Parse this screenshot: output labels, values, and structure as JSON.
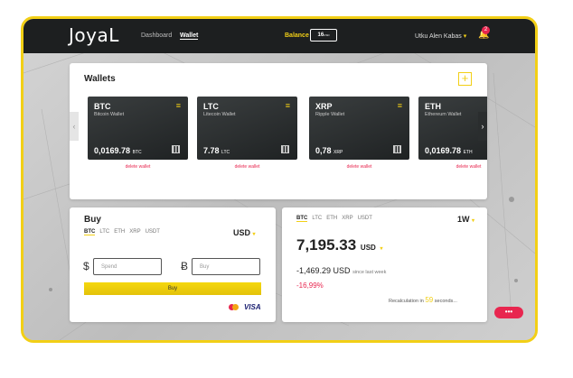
{
  "app": {
    "logo": "JoyaL"
  },
  "nav": [
    {
      "label": "Dashboard"
    },
    {
      "label": "Wallet"
    }
  ],
  "balance": {
    "label": "Balance",
    "value": "16",
    "unit": "USD"
  },
  "user": {
    "name": "Utku Alen Kabas",
    "notifications": "2"
  },
  "wallets": {
    "title": "Wallets",
    "add_label": "+",
    "delete_label": "delete wallet",
    "cards": [
      {
        "symbol": "BTC",
        "name": "Bitcoin Wallet",
        "amount": "0,0169.78",
        "unit": "BTC"
      },
      {
        "symbol": "LTC",
        "name": "Litecoin Wallet",
        "amount": "7.78",
        "unit": "LTC"
      },
      {
        "symbol": "XRP",
        "name": "Ripple Wallet",
        "amount": "0,78",
        "unit": "XRP"
      },
      {
        "symbol": "ETH",
        "name": "Ethereum Wallet",
        "amount": "0,0169.78",
        "unit": "ETH"
      }
    ]
  },
  "buy": {
    "title": "Buy",
    "coins": [
      "BTC",
      "LTC",
      "ETH",
      "XRP",
      "USDT"
    ],
    "currency": "USD",
    "spend_symbol": "$",
    "spend_placeholder": "Spend",
    "buy_symbol": "Ƀ",
    "buy_placeholder": "Buy",
    "button_label": "Buy",
    "visa_label": "VISA"
  },
  "rates": {
    "coins": [
      "BTC",
      "LTC",
      "ETH",
      "XRP",
      "USDT"
    ],
    "period": "1W",
    "price": "7,195.33",
    "price_unit": "USD",
    "change": "-1,469.29 USD",
    "change_suffix": "since last week",
    "percent": "-16,99%",
    "recalc_prefix": "Recalculation in",
    "recalc_seconds": "59",
    "recalc_suffix": "seconds..."
  },
  "chat": {
    "label": "•••"
  },
  "colors": {
    "accent": "#f2cf16",
    "danger": "#e8264f",
    "dark": "#1d1f20"
  }
}
